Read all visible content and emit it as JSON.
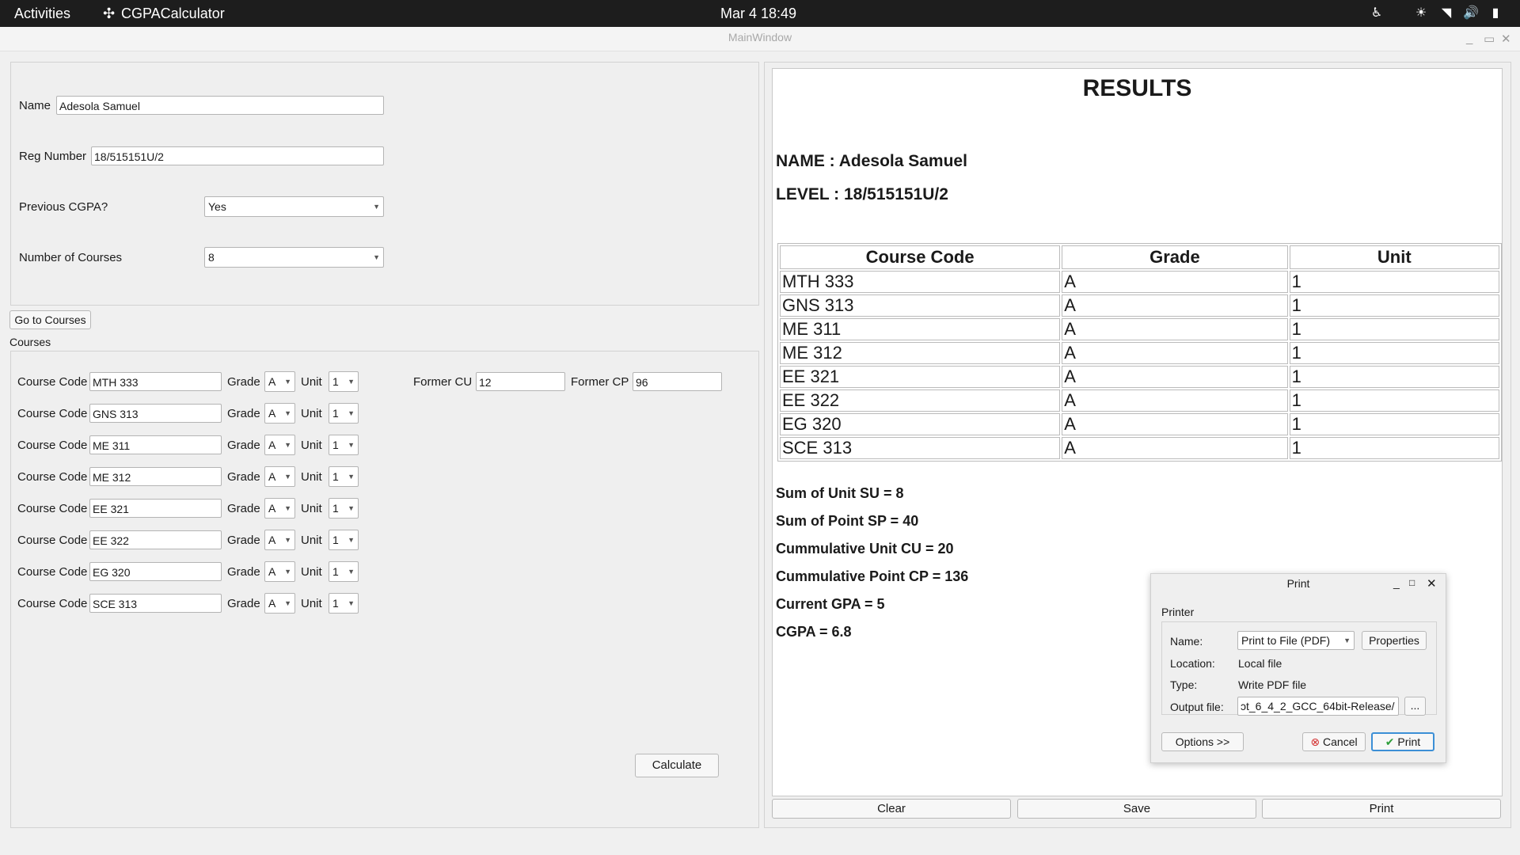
{
  "topbar": {
    "activities": "Activities",
    "app_name": "CGPACalculator",
    "clock": "Mar 4  18:49"
  },
  "window": {
    "title": "MainWindow"
  },
  "form": {
    "name_label": "Name",
    "name_value": "Adesola Samuel",
    "reg_label": "Reg Number",
    "reg_value": "18/515151U/2",
    "prev_label": "Previous CGPA?",
    "prev_value": "Yes",
    "num_label": "Number of Courses",
    "num_value": "8",
    "go_button": "Go to Courses",
    "courses_title": "Courses"
  },
  "courses_panel": {
    "code_label": "Course Code",
    "grade_label": "Grade",
    "unit_label": "Unit",
    "rows": [
      {
        "code": "MTH 333",
        "grade": "A",
        "unit": "1"
      },
      {
        "code": "GNS 313",
        "grade": "A",
        "unit": "1"
      },
      {
        "code": "ME 311",
        "grade": "A",
        "unit": "1"
      },
      {
        "code": "ME 312",
        "grade": "A",
        "unit": "1"
      },
      {
        "code": "EE 321",
        "grade": "A",
        "unit": "1"
      },
      {
        "code": "EE 322",
        "grade": "A",
        "unit": "1"
      },
      {
        "code": "EG 320",
        "grade": "A",
        "unit": "1"
      },
      {
        "code": "SCE 313",
        "grade": "A",
        "unit": "1"
      }
    ],
    "former_cu_label": "Former CU",
    "former_cu_value": "12",
    "former_cp_label": "Former CP",
    "former_cp_value": "96",
    "calculate": "Calculate"
  },
  "results": {
    "heading": "RESULTS",
    "name_line": "NAME : Adesola Samuel",
    "level_line": "LEVEL : 18/515151U/2",
    "columns": [
      "Course Code",
      "Grade",
      "Unit"
    ],
    "rows": [
      [
        "MTH 333",
        "A",
        "1"
      ],
      [
        "GNS 313",
        "A",
        "1"
      ],
      [
        "ME 311",
        "A",
        "1"
      ],
      [
        "ME 312",
        "A",
        "1"
      ],
      [
        "EE 321",
        "A",
        "1"
      ],
      [
        "EE 322",
        "A",
        "1"
      ],
      [
        "EG 320",
        "A",
        "1"
      ],
      [
        "SCE 313",
        "A",
        "1"
      ]
    ],
    "summary": [
      "Sum of Unit SU = 8",
      "Sum of Point SP = 40",
      "Cummulative Unit CU = 20",
      "Cummulative Point CP = 136",
      "Current GPA = 5",
      "CGPA = 6.8"
    ]
  },
  "bottom_buttons": {
    "clear": "Clear",
    "save": "Save",
    "print": "Print"
  },
  "print_dialog": {
    "title": "Print",
    "printer_group": "Printer",
    "name_label": "Name:",
    "name_value": "Print to File (PDF)",
    "properties": "Properties",
    "location_label": "Location:",
    "location_value": "Local file",
    "type_label": "Type:",
    "type_value": "Write PDF file",
    "output_label": "Output file:",
    "output_value": "ɔt_6_4_2_GCC_64bit-Release/",
    "browse": "...",
    "options": "Options >>",
    "cancel": "Cancel",
    "print": "Print"
  },
  "colors": {
    "topbar": "#1d1d1d",
    "ok_green": "#2e9e3a",
    "cancel_red": "#d32f2f",
    "focus_blue": "#3c8fd6"
  }
}
